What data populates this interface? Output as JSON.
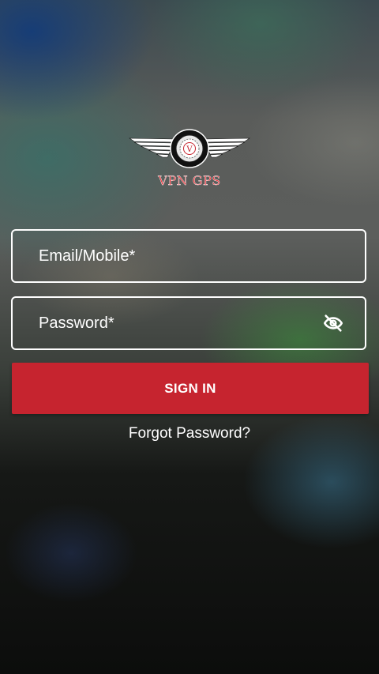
{
  "logo": {
    "emblem_letter": "V",
    "name": "VPN GPS",
    "name_color": "#e8343a"
  },
  "form": {
    "email_label": "Email/Mobile*",
    "password_label": "Password*",
    "password_toggle_icon": "eye-off-icon",
    "sign_in_label": "SIGN IN",
    "sign_in_color": "#c6242f",
    "forgot_password_label": "Forgot Password?"
  }
}
